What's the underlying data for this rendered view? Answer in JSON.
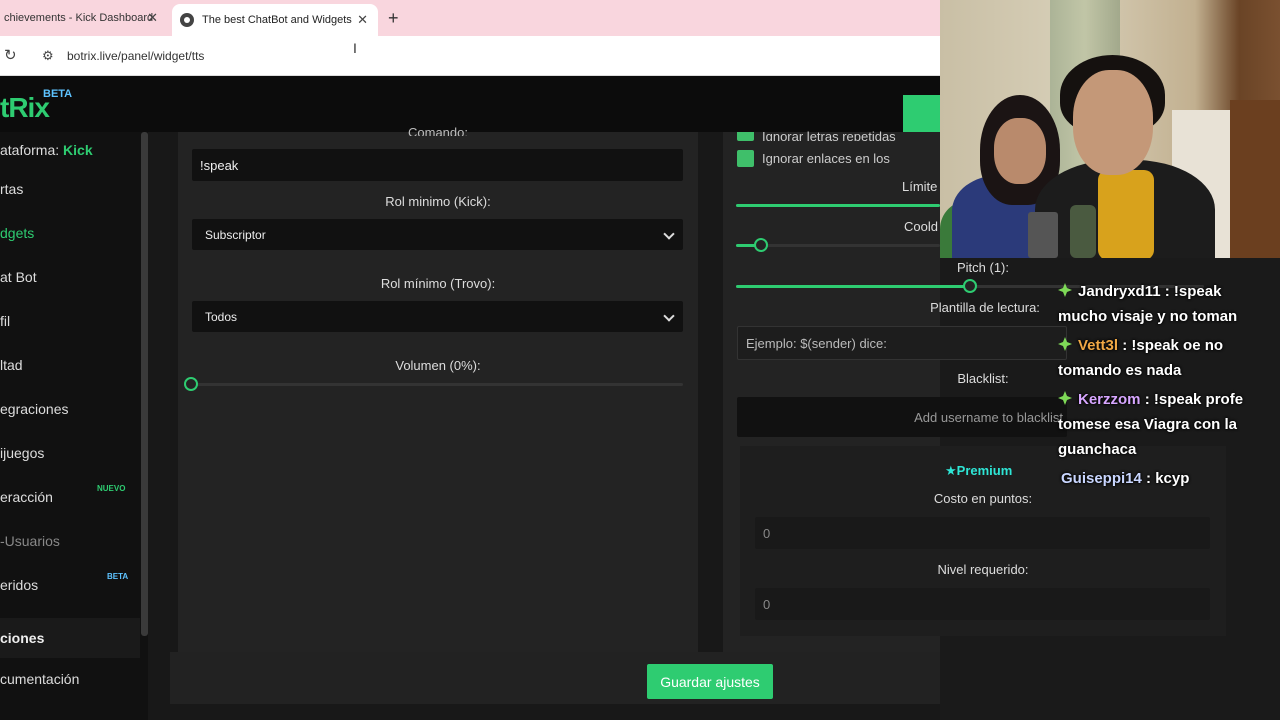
{
  "browser": {
    "tabs": [
      {
        "label": "chievements - Kick Dashboard"
      },
      {
        "label": "The best ChatBot and Widgets"
      }
    ],
    "url": "botrix.live/panel/widget/tts"
  },
  "app": {
    "logo": "tRix",
    "beta": "BETA"
  },
  "sidebar": {
    "platform_label": "ataforma:",
    "platform_value": "Kick",
    "items": [
      {
        "label": "rtas"
      },
      {
        "label": "dgets"
      },
      {
        "label": "at Bot"
      },
      {
        "label": "fil"
      },
      {
        "label": "ltad"
      },
      {
        "label": "egraciones"
      },
      {
        "label": "ijuegos"
      },
      {
        "label": "eracción",
        "badge": "NUEVO"
      },
      {
        "label": "-Usuarios"
      },
      {
        "label": "eridos",
        "badge": "BETA"
      },
      {
        "label": "ciones"
      },
      {
        "label": "cumentación"
      }
    ]
  },
  "left_panel": {
    "command_label": "Comando:",
    "command_value": "!speak",
    "kick_role_label": "Rol minimo (Kick):",
    "kick_role_value": "Subscriptor",
    "trovo_role_label": "Rol mínimo (Trovo):",
    "trovo_role_value": "Todos",
    "volume_label": "Volumen (0%):",
    "volume_value": 0
  },
  "right_panel": {
    "check_repeated": "Ignorar letras repetidas",
    "check_links": "Ignorar enlaces en los",
    "limit_label": "Límite",
    "cooldown_label": "Coold",
    "pitch_label": "Pitch (1):",
    "pitch_value": 0.5,
    "template_label": "Plantilla de lectura:",
    "template_placeholder": "Ejemplo: $(sender) dice:",
    "blacklist_label": "Blacklist:",
    "blacklist_placeholder": "Add username to blacklist",
    "premium_label": "Premium",
    "cost_label": "Costo en puntos:",
    "cost_value": "0",
    "level_label": "Nivel requerido:",
    "level_value": "0"
  },
  "save_label": "Guardar ajustes",
  "chat": [
    {
      "user": "Jandryxd11",
      "text": ": !speak",
      "cont": "mucho visaje y no toman"
    },
    {
      "user": "Vett3l",
      "text": ": !speak oe no",
      "cont": "tomando es nada"
    },
    {
      "user": "Kerzzom",
      "text": ": !speak profe",
      "cont": "tomese esa Viagra con la",
      "cont2": "guanchaca"
    },
    {
      "user": "Guiseppi14",
      "text": ": kcyp"
    }
  ],
  "colors": {
    "accent": "#2ecc71",
    "beta": "#5ec3ff",
    "premium": "#2ee6d6"
  }
}
